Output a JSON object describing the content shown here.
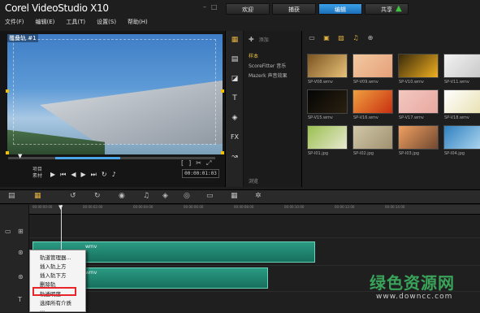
{
  "app": {
    "logo": "Corel VideoStudio X10"
  },
  "menu": [
    "文件(F)",
    "编辑(E)",
    "工具(T)",
    "设置(S)",
    "帮助(H)"
  ],
  "tabs": [
    {
      "label": "欢迎",
      "active": false
    },
    {
      "label": "捕获",
      "active": false
    },
    {
      "label": "编辑",
      "active": true
    },
    {
      "label": "共享",
      "active": false
    }
  ],
  "preview": {
    "track_label": "覆叠轨 #1",
    "project_label": "项目",
    "clip_label": "素材",
    "timecode": "00:00:01:03"
  },
  "library": {
    "add_label": "添加",
    "items": [
      {
        "label": "样本",
        "selected": true
      },
      {
        "label": "ScoreFitter 音乐",
        "selected": false
      },
      {
        "label": "Mazerk 声音效果",
        "selected": false
      }
    ],
    "browse_label": "浏览",
    "thumbnails": [
      {
        "caption": "SP-V08.wmv",
        "colors": [
          "#7a5420",
          "#e9c27a"
        ]
      },
      {
        "caption": "SP-V09.wmv",
        "colors": [
          "#f2c9a0",
          "#e6a07a"
        ]
      },
      {
        "caption": "SP-V10.wmv",
        "colors": [
          "#3a2a0a",
          "#f0b020"
        ]
      },
      {
        "caption": "SP-V11.wmv",
        "colors": [
          "#f2f2f2",
          "#c8c8c8"
        ]
      },
      {
        "caption": "SP-V15.wmv",
        "colors": [
          "#050505",
          "#2a2010"
        ]
      },
      {
        "caption": "SP-V16.wmv",
        "colors": [
          "#f0a040",
          "#c83010"
        ]
      },
      {
        "caption": "SP-V17.wmv",
        "colors": [
          "#f2c8c0",
          "#e8a8a0"
        ]
      },
      {
        "caption": "SP-V18.wmv",
        "colors": [
          "#ffffff",
          "#e8e0b0"
        ]
      },
      {
        "caption": "SP-I01.jpg",
        "colors": [
          "#9ac050",
          "#e8e8d0"
        ]
      },
      {
        "caption": "SP-I02.jpg",
        "colors": [
          "#d0c8a8",
          "#a09070"
        ]
      },
      {
        "caption": "SP-I03.jpg",
        "colors": [
          "#f0a060",
          "#704830"
        ]
      },
      {
        "caption": "SP-I04.jpg",
        "colors": [
          "#3080c0",
          "#b0d8f0"
        ]
      }
    ]
  },
  "timeline": {
    "ticks": [
      "00:00:00:00",
      "00:00:02:00",
      "00:00:04:00",
      "00:00:06:00",
      "00:00:08:00",
      "00:00:10:00",
      "00:00:12:00",
      "00:00:14:00"
    ],
    "clips": [
      {
        "label": "wmv"
      },
      {
        "label": "wmv"
      }
    ]
  },
  "context_menu": {
    "items": [
      "轨道管理器...",
      "插入轨上方",
      "插入轨下方",
      "删除轨",
      "轨透明度",
      "选择所有介质",
      "..."
    ],
    "highlighted": "轨透明度"
  },
  "watermark": {
    "cn": "绿色资源网",
    "url": "www.downcc.com"
  }
}
